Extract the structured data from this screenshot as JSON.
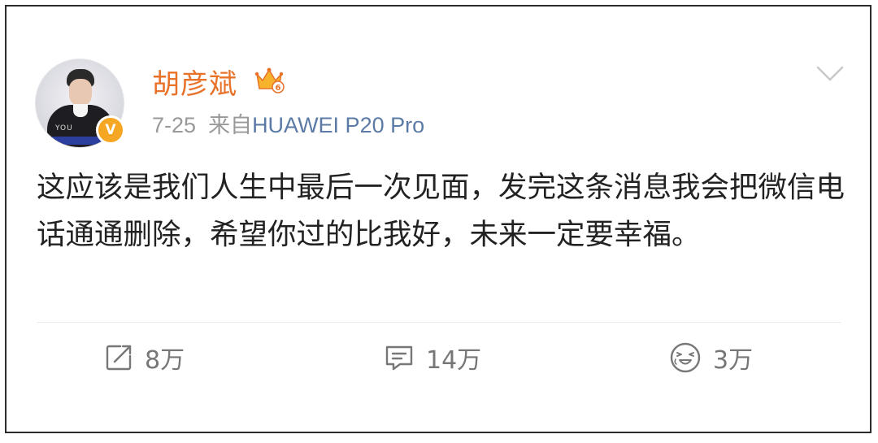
{
  "post": {
    "username": "胡彦斌",
    "time": "7-25",
    "source_prefix": "来自",
    "source_device": "HUAWEI P20 Pro",
    "level_badge": "6",
    "verified_badge": "V",
    "avatar_tag": "YOU",
    "content": "这应该是我们人生中最后一次见面，发完这条消息我会把微信电话通通删除，希望你过的比我好，未来一定要幸福。"
  },
  "actions": {
    "repost_count": "8万",
    "comment_count": "14万",
    "like_count": "3万"
  },
  "icons": {
    "repost": "share-square-icon",
    "comment": "comment-bubble-icon",
    "like": "laughing-face-icon",
    "menu": "chevron-down-icon",
    "crown": "crown-level-icon"
  },
  "colors": {
    "username": "#e8722a",
    "source_link": "#5b7ba6",
    "verified": "#f5a623",
    "meta": "#999999"
  }
}
